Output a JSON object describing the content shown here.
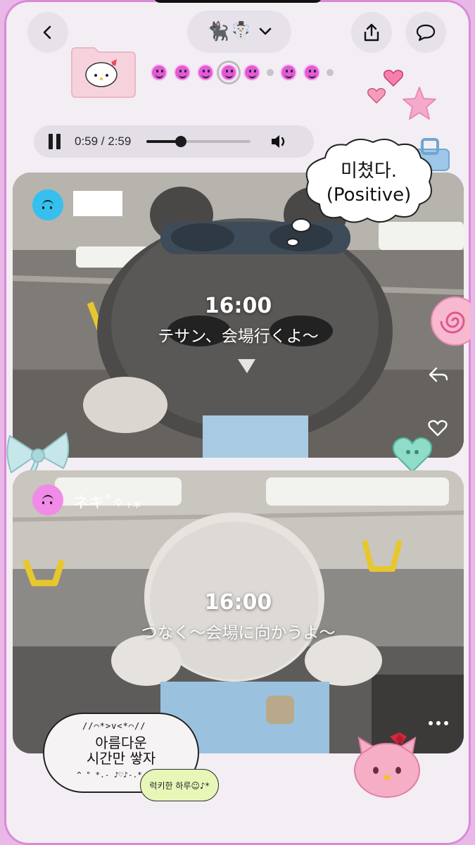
{
  "header": {
    "back_icon": "chevron-left-icon",
    "title_emojis": "🐈‍⬛☃️",
    "dropdown_icon": "chevron-down-icon",
    "share_icon": "share-icon",
    "comment_icon": "speech-bubble-icon"
  },
  "pager": {
    "items": [
      "smile",
      "smile",
      "smile",
      "smile-active",
      "smile",
      "dot",
      "smile",
      "smile",
      "dot"
    ]
  },
  "player": {
    "state": "playing",
    "time": "0:59 / 2:59",
    "progress": 0.33
  },
  "bubble": {
    "line1": "미쳤다.",
    "line2": "(Positive)"
  },
  "posts": [
    {
      "name": "",
      "time": "16:00",
      "message": "テサン、会場行くよ〜"
    },
    {
      "name": "ネキ˚✧₊⁎",
      "time": "16:00",
      "message": "つなく〜会場に向かうよ〜"
    }
  ],
  "stamp": {
    "top": "//⌒*>v<*⌒//",
    "line1": "아름다운",
    "line2": "시간만 쌓자",
    "bottom": "^ ° *.- ♪♡♪-.* ° ^"
  },
  "lucky": "럭키한 하루☺♪*",
  "colors": {
    "accent": "#e35ad7",
    "avatar1": "#35c0ef",
    "avatar2": "#f28ae8",
    "frame": "#e9b7e8"
  }
}
